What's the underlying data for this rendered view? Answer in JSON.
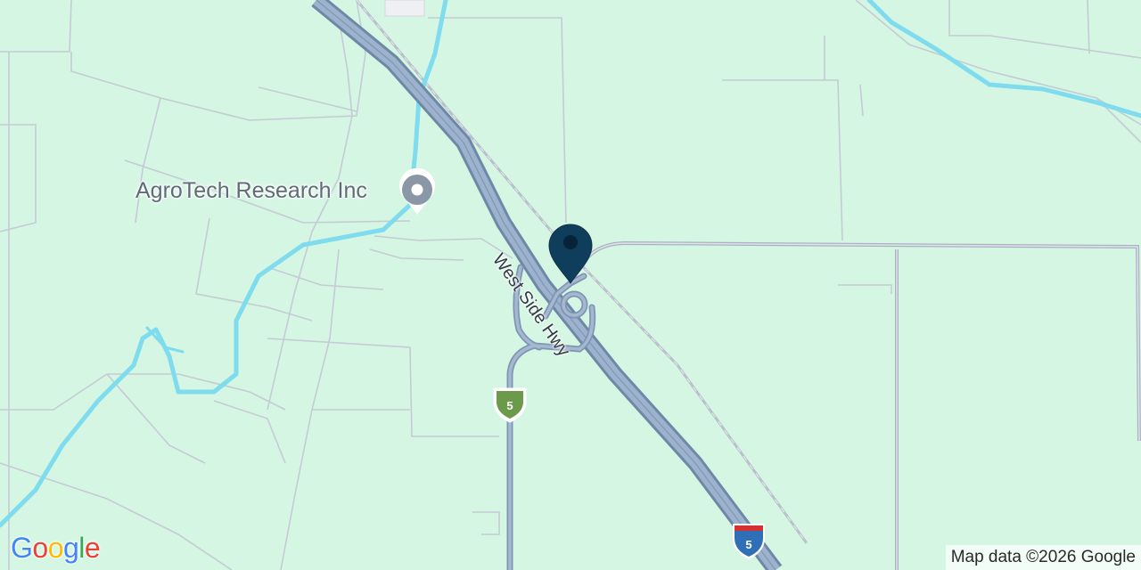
{
  "map": {
    "poi": {
      "name": "AgroTech Research Inc",
      "icon": "place-pin-icon"
    },
    "road_label": "West Side Hwy",
    "shields": [
      {
        "route": "5",
        "type": "state-route",
        "color": "#6a9a4a"
      },
      {
        "route": "5",
        "type": "interstate",
        "color": "#2f6fb6"
      }
    ],
    "marker": {
      "icon": "location-marker-icon",
      "color": "#0f3d5c"
    },
    "attribution": "Map data ©2026 Google",
    "logo": {
      "letters": [
        "G",
        "o",
        "o",
        "g",
        "l",
        "e"
      ],
      "colors": [
        "#4285f4",
        "#ea4335",
        "#fbbc05",
        "#4285f4",
        "#34a853",
        "#ea4335"
      ]
    },
    "colors": {
      "land": "#d4f6e2",
      "water": "#7fdcee",
      "highway": "#8fa7c4",
      "road": "#c9ccd6"
    }
  }
}
